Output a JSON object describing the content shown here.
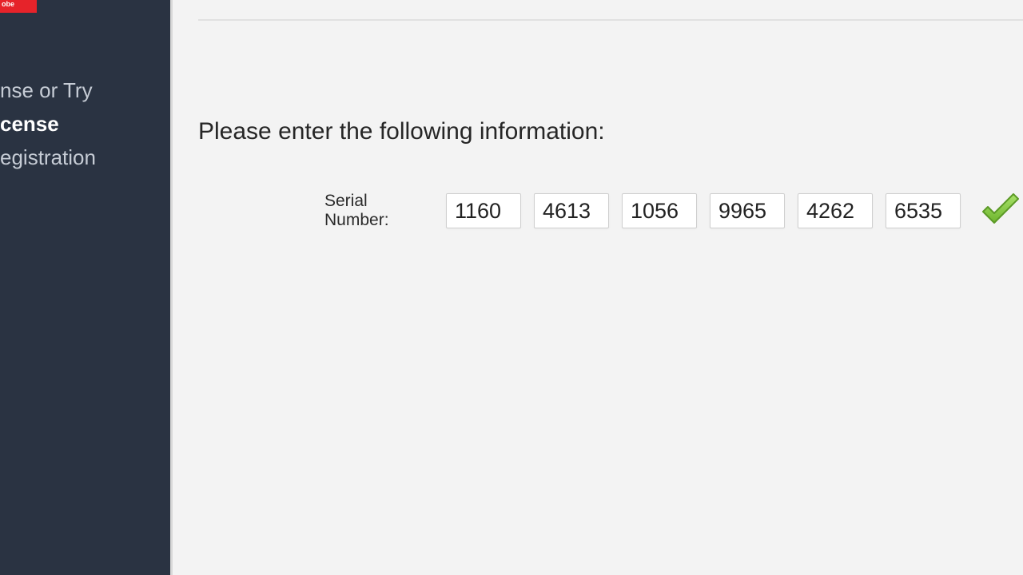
{
  "sidebar": {
    "logo_text": "obe",
    "items": [
      {
        "label": "nse or Try",
        "active": false
      },
      {
        "label": "cense",
        "active": true
      },
      {
        "label": "egistration",
        "active": false
      }
    ]
  },
  "content": {
    "prompt": "Please enter the following information:",
    "serial_label": "Serial Number:",
    "serial_parts": [
      "1160",
      "4613",
      "1056",
      "9965",
      "4262",
      "6535"
    ],
    "valid_icon": "checkmark-icon"
  },
  "colors": {
    "sidebar_bg": "#2a3342",
    "logo_bg": "#e6232a",
    "content_bg": "#f3f3f3",
    "check_green": "#7fbf3a"
  }
}
